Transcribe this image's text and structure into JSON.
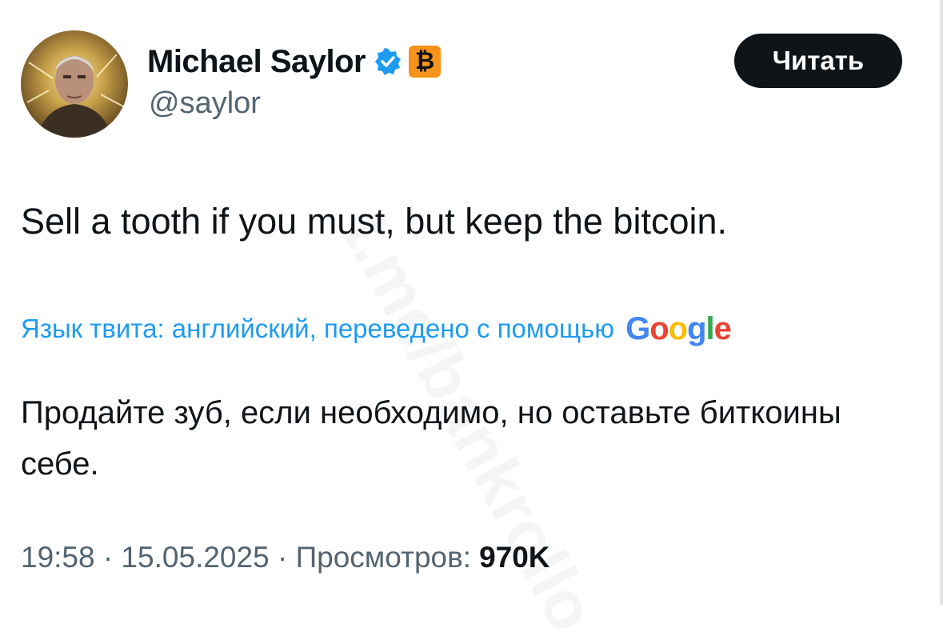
{
  "author": {
    "name": "Michael Saylor",
    "handle": "@saylor",
    "verified_icon": "verified-badge-icon",
    "badge_icon": "bitcoin-badge-icon",
    "badge_symbol": "₿",
    "badge_color": "#f7931a",
    "verified_color": "#1d9bf0"
  },
  "follow_button": {
    "label": "Читать"
  },
  "tweet": {
    "text": "Sell a tooth if you must, but keep the bitcoin."
  },
  "translation": {
    "label": "Язык твита: английский, переведено с помощью",
    "provider_logo": [
      "G",
      "o",
      "o",
      "g",
      "l",
      "e"
    ],
    "text": "Продайте зуб, если необходимо, но оставьте биткоины себе."
  },
  "meta": {
    "time": "19:58",
    "separator": "·",
    "date": "15.05.2025",
    "views_label": "Просмотров:",
    "views_count": "970K"
  },
  "watermark": "t.me/bankrollo"
}
